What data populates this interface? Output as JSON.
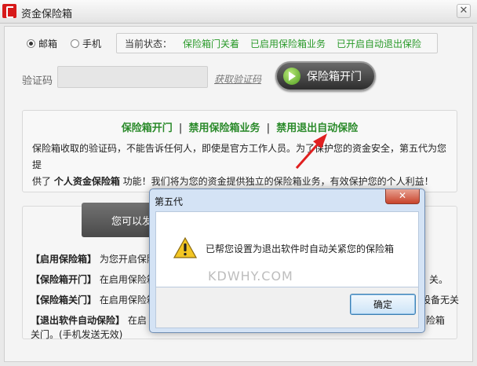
{
  "window": {
    "title": "资金保险箱",
    "close_glyph": "✕"
  },
  "mode": {
    "options": [
      {
        "label": "邮箱",
        "selected": true
      },
      {
        "label": "手机",
        "selected": false
      }
    ]
  },
  "status": {
    "label": "当前状态：",
    "items": [
      "保险箱门关着",
      "已启用保险箱业务",
      "已开启自动退出保险"
    ]
  },
  "code": {
    "label": "验证码",
    "value": "",
    "get_link": "获取验证码"
  },
  "open_button": {
    "label": "保险箱开门",
    "icon": "green-arrow-icon"
  },
  "info": {
    "heading": [
      "保险箱开门",
      "禁用保险箱业务",
      "禁用退出自动保险"
    ],
    "separator": "|",
    "line1": "保险箱收取的验证码，不能告诉任何人，即使是官方工作人员。为了保护您的资金安全，第五代为您提",
    "line2_pre": "供了 ",
    "line2_bold": "个人资金保险箱",
    "line2_post": " 功能！我们将为您的资金提供独立的保险箱业务，有效保护您的个人利益！"
  },
  "tooltip": {
    "text": "您可以发"
  },
  "descriptions": [
    {
      "title": "【启用保险箱】",
      "text": "为您开启保险"
    },
    {
      "title": "【保险箱开门】",
      "text": "在启用保险箱",
      "tail": "关。"
    },
    {
      "title": "【保险箱关门】",
      "text": "在启用保险箱",
      "tail": "设备无关"
    },
    {
      "title": "【退出软件自动保险】",
      "text": "在启",
      "tail": "保 险箱"
    }
  ],
  "description_footer": "关门。(手机发送无效)",
  "dialog": {
    "title": "第五代",
    "close_glyph": "✕",
    "message": "已帮您设置为退出软件时自动关紧您的保险箱",
    "watermark": "KDWHY.COM",
    "ok_label": "确定",
    "icon": "warning-icon"
  },
  "colors": {
    "accent_green": "#2a8a2a",
    "status_green": "#2a9a2a",
    "brand_red": "#d71a1a"
  }
}
